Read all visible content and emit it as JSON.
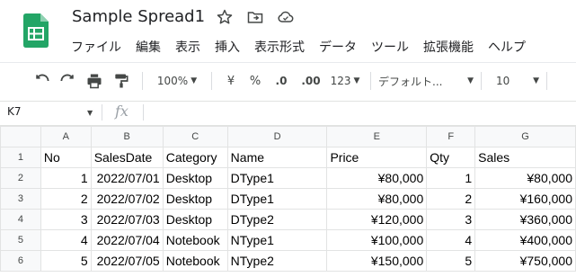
{
  "app": {
    "title": "Sample Spread1",
    "menu": [
      "ファイル",
      "編集",
      "表示",
      "挿入",
      "表示形式",
      "データ",
      "ツール",
      "拡張機能",
      "ヘルプ"
    ]
  },
  "toolbar": {
    "zoom": "100%",
    "currency": "¥",
    "percent": "%",
    "decrease_decimal": ".0",
    "increase_decimal": ".00",
    "number_format": "123",
    "font": "デフォルト...",
    "font_size": "10"
  },
  "formula_bar": {
    "name_box": "K7",
    "fx_label": "fx"
  },
  "sheet": {
    "columns": [
      "A",
      "B",
      "C",
      "D",
      "E",
      "F",
      "G"
    ],
    "rows": [
      {
        "n": "1",
        "cells": [
          "No",
          "SalesDate",
          "Category",
          "Name",
          "Price",
          "Qty",
          "Sales"
        ]
      },
      {
        "n": "2",
        "cells": [
          "1",
          "2022/07/01",
          "Desktop",
          "DType1",
          "¥80,000",
          "1",
          "¥80,000"
        ]
      },
      {
        "n": "3",
        "cells": [
          "2",
          "2022/07/02",
          "Desktop",
          "DType1",
          "¥80,000",
          "2",
          "¥160,000"
        ]
      },
      {
        "n": "4",
        "cells": [
          "3",
          "2022/07/03",
          "Desktop",
          "DType2",
          "¥120,000",
          "3",
          "¥360,000"
        ]
      },
      {
        "n": "5",
        "cells": [
          "4",
          "2022/07/04",
          "Notebook",
          "NType1",
          "¥100,000",
          "4",
          "¥400,000"
        ]
      },
      {
        "n": "6",
        "cells": [
          "5",
          "2022/07/05",
          "Notebook",
          "NType2",
          "¥150,000",
          "5",
          "¥750,000"
        ]
      }
    ]
  },
  "colors": {
    "logo_green": "#23a566",
    "header_bg": "#f8f9fa",
    "grid_line": "#e2e3e3"
  },
  "icons": [
    "sheets-logo",
    "star-icon",
    "move-folder-icon",
    "cloud-status-icon",
    "undo-icon",
    "redo-icon",
    "print-icon",
    "paint-format-icon"
  ]
}
